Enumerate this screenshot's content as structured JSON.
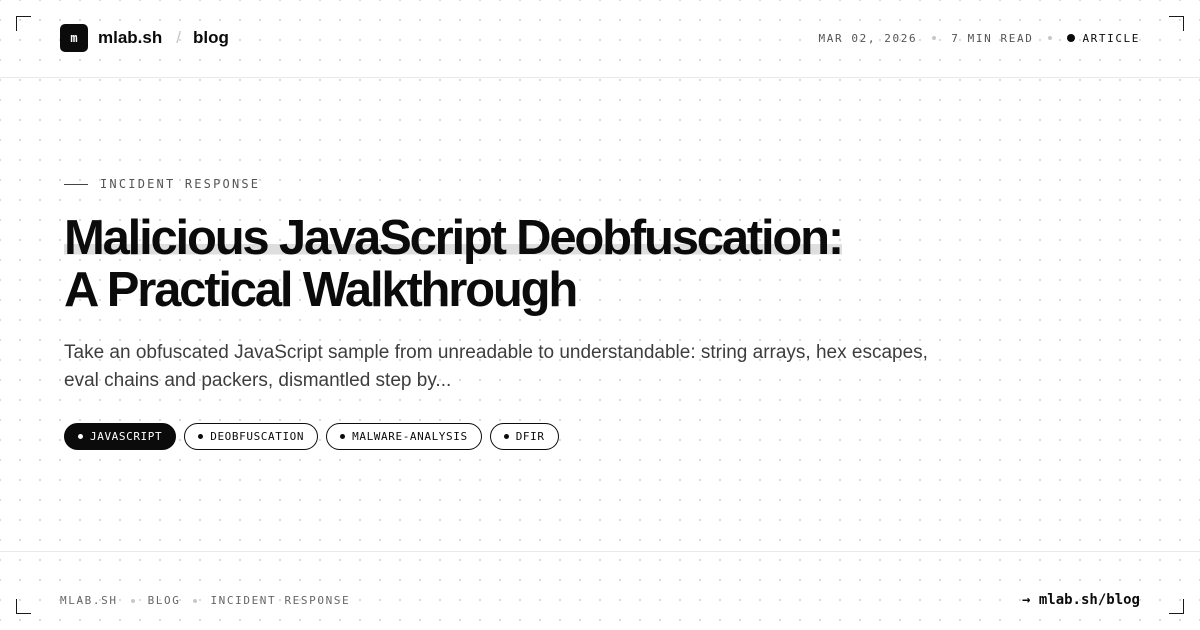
{
  "header": {
    "logo_glyph": "m",
    "brand": "mlab.sh",
    "separator": "/",
    "section": "blog",
    "meta": {
      "date": "MAR 02, 2026",
      "read_time": "7 MIN READ",
      "type": "ARTICLE"
    }
  },
  "article": {
    "category": "INCIDENT RESPONSE",
    "title_line1": "Malicious JavaScript Deobfuscation:",
    "title_line2": "A Practical Walkthrough",
    "summary": "Take an obfuscated JavaScript sample from unreadable to understandable: string arrays, hex escapes, eval chains and packers, dismantled step by...",
    "tags": [
      {
        "label": "JAVASCRIPT",
        "active": true
      },
      {
        "label": "DEOBFUSCATION",
        "active": false
      },
      {
        "label": "MALWARE-ANALYSIS",
        "active": false
      },
      {
        "label": "DFIR",
        "active": false
      }
    ]
  },
  "footer": {
    "breadcrumb": [
      "MLAB.SH",
      "BLOG",
      "INCIDENT RESPONSE"
    ],
    "link": "→ mlab.sh/blog"
  },
  "colors": {
    "ink": "#0b0b0b",
    "muted": "#555555",
    "divider": "#e8e8e8",
    "grid_dot": "#d9d9d9"
  }
}
